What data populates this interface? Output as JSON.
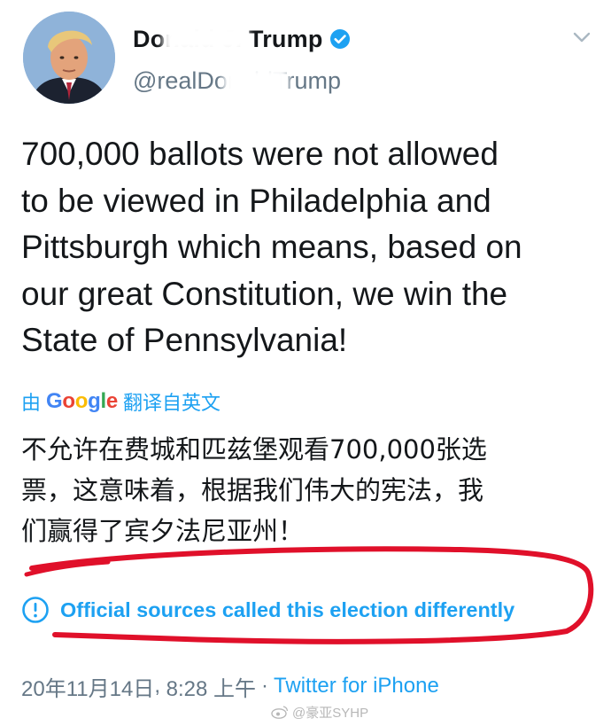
{
  "header": {
    "display_name": "Donald J. Trump",
    "handle": "@realDonaldTrump",
    "verified_icon": "verified-badge-icon",
    "menu_icon": "chevron-down-icon"
  },
  "tweet": {
    "lines": [
      "700,000 ballots were not allowed",
      "to be viewed in Philadelphia and",
      "Pittsburgh which means, based on",
      "our great Constitution, we win the",
      "State of Pennsylvania!"
    ]
  },
  "translation": {
    "prefix": "由",
    "provider": "Google",
    "suffix": "翻译自英文",
    "lines": [
      "不允许在费城和匹兹堡观看700,000张选",
      "票，这意味着，根据我们伟大的宪法，我",
      "们赢得了宾夕法尼亚州！"
    ]
  },
  "notice": {
    "icon": "info-circle-icon",
    "text": "Official sources called this election differently"
  },
  "meta": {
    "date": "20年11月14日",
    "time": "8:28 上午",
    "separator": "·",
    "source": "Twitter for iPhone"
  },
  "watermark": {
    "icon": "weibo-icon",
    "text": "@豪亚SYHP"
  },
  "colors": {
    "accent": "#1da1f2",
    "secondary_text": "#657786",
    "annotation": "#e0102a"
  }
}
